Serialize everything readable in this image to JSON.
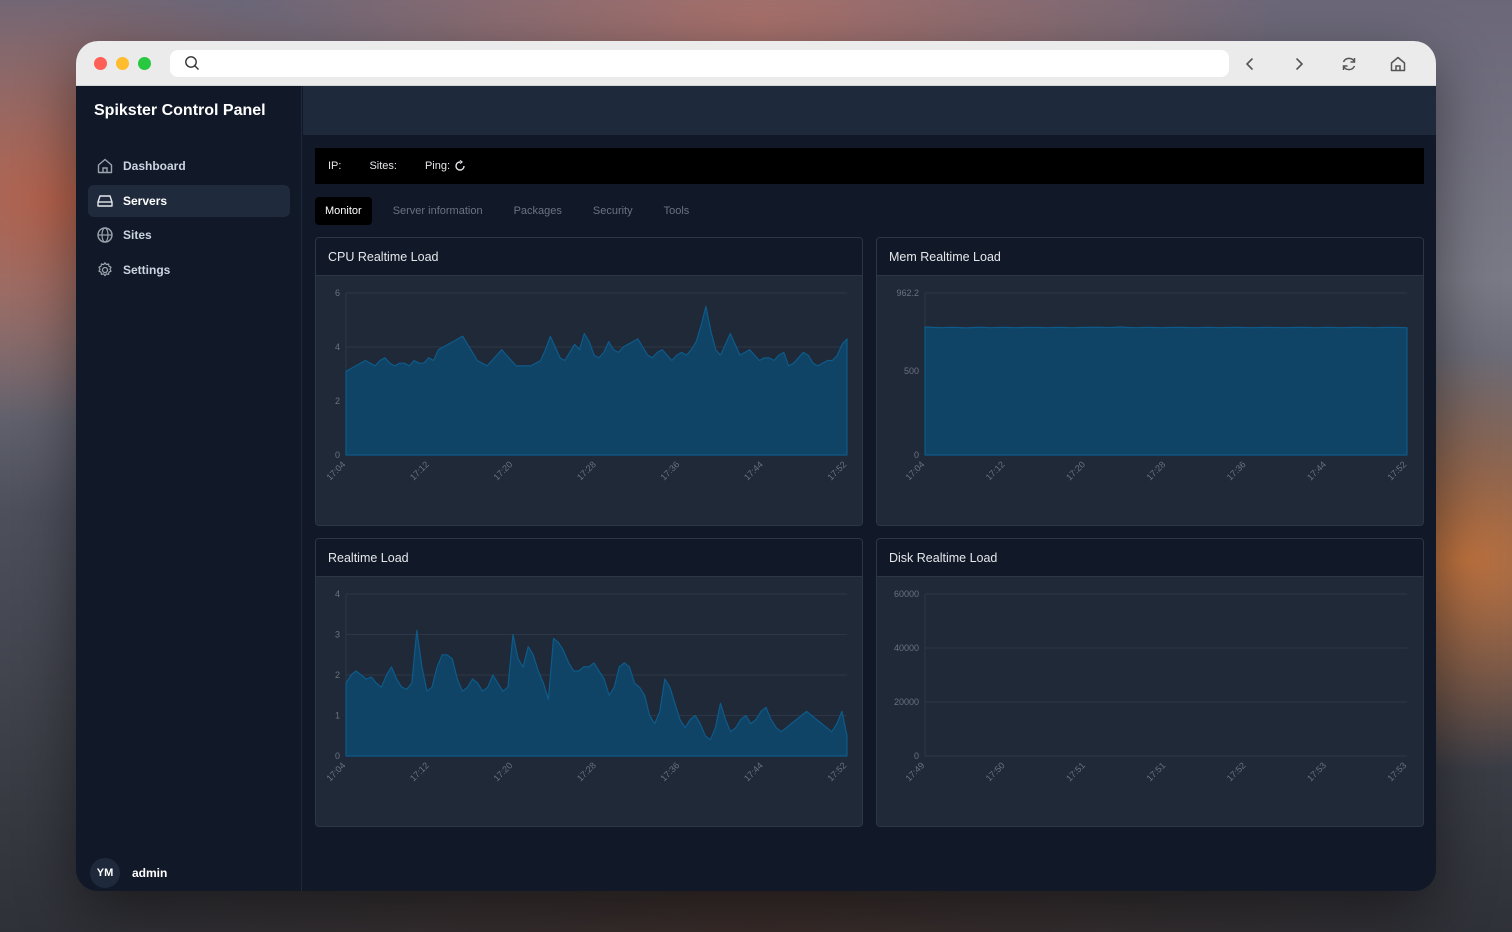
{
  "browser": {
    "url": ""
  },
  "sidebar": {
    "brand": "Spikster Control Panel",
    "items": [
      {
        "label": "Dashboard",
        "icon": "home-icon"
      },
      {
        "label": "Servers",
        "icon": "server-icon",
        "active": true
      },
      {
        "label": "Sites",
        "icon": "globe-icon"
      },
      {
        "label": "Settings",
        "icon": "gear-icon"
      }
    ],
    "user": {
      "initials": "YM",
      "name": "admin"
    }
  },
  "infobar": {
    "ip_label": "IP:",
    "sites_label": "Sites:",
    "ping_label": "Ping:"
  },
  "tabs": [
    {
      "label": "Monitor",
      "active": true
    },
    {
      "label": "Server information"
    },
    {
      "label": "Packages"
    },
    {
      "label": "Security"
    },
    {
      "label": "Tools"
    }
  ],
  "colors": {
    "area_fill": "#0f4466",
    "area_line": "#0e5a8a",
    "accent": "#111827"
  },
  "chart_data": [
    {
      "type": "area",
      "title": "CPU Realtime Load",
      "ylim": [
        0,
        6
      ],
      "yticks": [
        "0",
        "2",
        "4",
        "6"
      ],
      "xticks": [
        "17:04",
        "17:12",
        "17:20",
        "17:28",
        "17:36",
        "17:44",
        "17:52"
      ],
      "values": [
        3.1,
        3.2,
        3.3,
        3.4,
        3.5,
        3.4,
        3.3,
        3.5,
        3.6,
        3.4,
        3.3,
        3.4,
        3.4,
        3.3,
        3.5,
        3.4,
        3.4,
        3.6,
        3.5,
        3.9,
        4.0,
        4.1,
        4.2,
        4.3,
        4.4,
        4.1,
        3.8,
        3.5,
        3.4,
        3.3,
        3.5,
        3.7,
        3.9,
        3.7,
        3.5,
        3.3,
        3.3,
        3.3,
        3.3,
        3.4,
        3.5,
        3.9,
        4.4,
        4.0,
        3.6,
        3.5,
        3.8,
        4.1,
        3.9,
        4.5,
        4.2,
        3.7,
        3.6,
        3.8,
        4.2,
        3.9,
        3.8,
        4.0,
        4.1,
        4.2,
        4.3,
        4.0,
        3.7,
        3.6,
        3.8,
        3.9,
        3.7,
        3.5,
        3.7,
        3.8,
        3.7,
        3.9,
        4.2,
        4.8,
        5.5,
        4.6,
        3.9,
        3.7,
        4.1,
        4.5,
        4.1,
        3.7,
        3.8,
        3.9,
        3.7,
        3.5,
        3.6,
        3.6,
        3.5,
        3.7,
        3.8,
        3.3,
        3.4,
        3.6,
        3.8,
        3.7,
        3.4,
        3.3,
        3.4,
        3.5,
        3.5,
        3.7,
        4.1,
        4.3
      ]
    },
    {
      "type": "area",
      "title": "Mem Realtime Load",
      "ylim": [
        0,
        962.2
      ],
      "yticks": [
        "0",
        "500",
        "962.2"
      ],
      "xticks": [
        "17:04",
        "17:12",
        "17:20",
        "17:28",
        "17:36",
        "17:44",
        "17:52"
      ],
      "values": [
        760,
        758,
        756,
        758,
        757,
        755,
        757,
        759,
        756,
        757,
        758,
        756,
        757,
        758,
        757,
        756,
        758,
        757,
        756,
        757,
        758,
        759,
        757,
        758,
        760,
        757,
        756,
        758,
        757,
        756,
        757,
        758,
        757,
        756,
        757,
        758,
        756,
        757,
        758,
        757,
        756,
        757,
        758,
        757,
        756,
        757,
        758,
        757,
        756,
        758,
        757,
        756,
        757,
        758,
        757,
        756,
        757,
        758,
        757,
        756
      ]
    },
    {
      "type": "area",
      "title": "Realtime Load",
      "ylim": [
        0,
        4
      ],
      "yticks": [
        "0",
        "1",
        "2",
        "3",
        "4"
      ],
      "xticks": [
        "17:04",
        "17:12",
        "17:20",
        "17:28",
        "17:36",
        "17:44",
        "17:52"
      ],
      "values": [
        1.8,
        2.0,
        2.1,
        2.0,
        1.9,
        1.95,
        1.8,
        1.7,
        2.0,
        2.2,
        1.9,
        1.7,
        1.65,
        1.8,
        3.1,
        2.2,
        1.6,
        1.7,
        2.2,
        2.5,
        2.5,
        2.4,
        1.9,
        1.6,
        1.7,
        1.9,
        1.8,
        1.6,
        1.7,
        2.0,
        1.8,
        1.6,
        1.7,
        3.0,
        2.4,
        2.2,
        2.7,
        2.5,
        2.1,
        1.8,
        1.4,
        2.9,
        2.8,
        2.6,
        2.3,
        2.1,
        2.1,
        2.2,
        2.2,
        2.3,
        2.1,
        1.9,
        1.5,
        1.7,
        2.2,
        2.3,
        2.2,
        1.8,
        1.7,
        1.5,
        1.0,
        0.8,
        1.1,
        1.9,
        1.7,
        1.3,
        0.9,
        0.7,
        0.9,
        1.0,
        0.8,
        0.5,
        0.4,
        0.7,
        1.3,
        0.9,
        0.6,
        0.7,
        0.9,
        1.0,
        0.8,
        0.9,
        1.1,
        1.2,
        0.9,
        0.7,
        0.6,
        0.7,
        0.8,
        0.9,
        1.0,
        1.1,
        1.0,
        0.9,
        0.8,
        0.7,
        0.6,
        0.8,
        1.1,
        0.5
      ]
    },
    {
      "type": "area",
      "title": "Disk Realtime Load",
      "ylim": [
        0,
        60000
      ],
      "yticks": [
        "0",
        "20000",
        "40000",
        "60000"
      ],
      "xticks": [
        "17:49",
        "17:50",
        "17:51",
        "17:51",
        "17:52",
        "17:53",
        "17:53"
      ],
      "values": []
    }
  ]
}
